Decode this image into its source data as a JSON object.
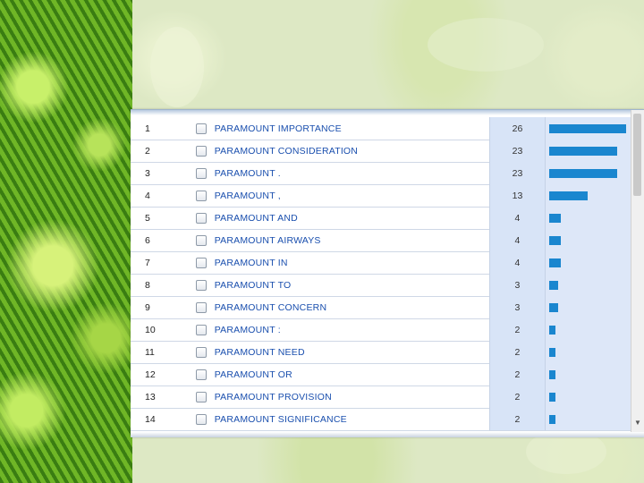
{
  "rows": [
    {
      "rank": "1",
      "phrase": "PARAMOUNT IMPORTANCE",
      "count": "26",
      "frequency": 26
    },
    {
      "rank": "2",
      "phrase": "PARAMOUNT CONSIDERATION",
      "count": "23",
      "frequency": 23
    },
    {
      "rank": "3",
      "phrase": "PARAMOUNT .",
      "count": "23",
      "frequency": 23
    },
    {
      "rank": "4",
      "phrase": "PARAMOUNT ,",
      "count": "13",
      "frequency": 13
    },
    {
      "rank": "5",
      "phrase": "PARAMOUNT AND",
      "count": "4",
      "frequency": 4
    },
    {
      "rank": "6",
      "phrase": "PARAMOUNT AIRWAYS",
      "count": "4",
      "frequency": 4
    },
    {
      "rank": "7",
      "phrase": "PARAMOUNT IN",
      "count": "4",
      "frequency": 4
    },
    {
      "rank": "8",
      "phrase": "PARAMOUNT TO",
      "count": "3",
      "frequency": 3
    },
    {
      "rank": "9",
      "phrase": "PARAMOUNT CONCERN",
      "count": "3",
      "frequency": 3
    },
    {
      "rank": "10",
      "phrase": "PARAMOUNT :",
      "count": "2",
      "frequency": 2
    },
    {
      "rank": "11",
      "phrase": "PARAMOUNT NEED",
      "count": "2",
      "frequency": 2
    },
    {
      "rank": "12",
      "phrase": "PARAMOUNT OR",
      "count": "2",
      "frequency": 2
    },
    {
      "rank": "13",
      "phrase": "PARAMOUNT PROVISION",
      "count": "2",
      "frequency": 2
    },
    {
      "rank": "14",
      "phrase": "PARAMOUNT SIGNIFICANCE",
      "count": "2",
      "frequency": 2
    }
  ],
  "colors": {
    "bar": "#1a86cf",
    "count_cell": "#d8e4f7",
    "phrase_text": "#1a4fae"
  },
  "icons": {
    "scroll_down": "scroll-down-arrow-icon"
  }
}
